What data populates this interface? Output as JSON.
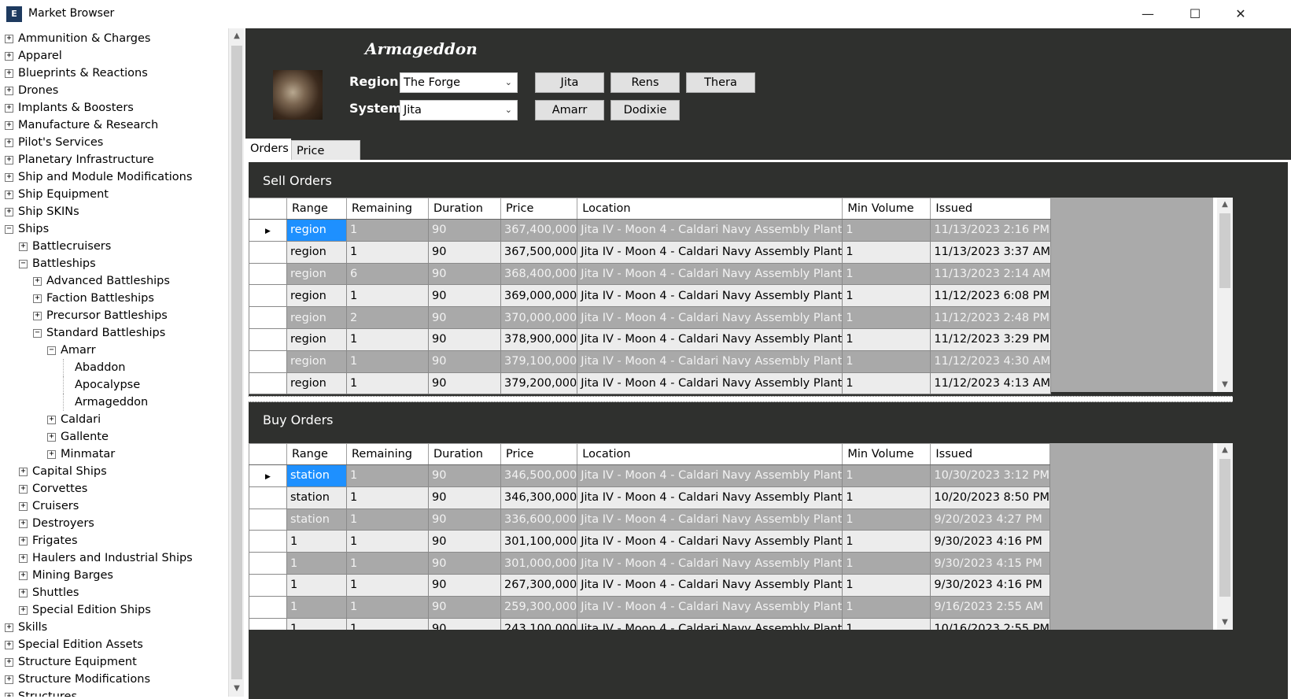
{
  "window": {
    "title": "Market Browser",
    "app_icon": "E"
  },
  "sidebar": {
    "items": [
      {
        "label": "Ammunition & Charges",
        "level": 0,
        "expanded": false
      },
      {
        "label": "Apparel",
        "level": 0,
        "expanded": false
      },
      {
        "label": "Blueprints & Reactions",
        "level": 0,
        "expanded": false
      },
      {
        "label": "Drones",
        "level": 0,
        "expanded": false
      },
      {
        "label": "Implants & Boosters",
        "level": 0,
        "expanded": false
      },
      {
        "label": "Manufacture & Research",
        "level": 0,
        "expanded": false
      },
      {
        "label": "Pilot's Services",
        "level": 0,
        "expanded": false
      },
      {
        "label": "Planetary Infrastructure",
        "level": 0,
        "expanded": false
      },
      {
        "label": "Ship and Module Modifications",
        "level": 0,
        "expanded": false
      },
      {
        "label": "Ship Equipment",
        "level": 0,
        "expanded": false
      },
      {
        "label": "Ship SKINs",
        "level": 0,
        "expanded": false
      },
      {
        "label": "Ships",
        "level": 0,
        "expanded": true
      },
      {
        "label": "Battlecruisers",
        "level": 1,
        "expanded": false
      },
      {
        "label": "Battleships",
        "level": 1,
        "expanded": true
      },
      {
        "label": "Advanced Battleships",
        "level": 2,
        "expanded": false
      },
      {
        "label": "Faction Battleships",
        "level": 2,
        "expanded": false
      },
      {
        "label": "Precursor Battleships",
        "level": 2,
        "expanded": false
      },
      {
        "label": "Standard Battleships",
        "level": 2,
        "expanded": true
      },
      {
        "label": "Amarr",
        "level": 3,
        "expanded": true
      },
      {
        "label": "Abaddon",
        "level": 4,
        "leaf": true
      },
      {
        "label": "Apocalypse",
        "level": 4,
        "leaf": true
      },
      {
        "label": "Armageddon",
        "level": 4,
        "leaf": true
      },
      {
        "label": "Caldari",
        "level": 3,
        "expanded": false
      },
      {
        "label": "Gallente",
        "level": 3,
        "expanded": false
      },
      {
        "label": "Minmatar",
        "level": 3,
        "expanded": false
      },
      {
        "label": "Capital Ships",
        "level": 1,
        "expanded": false
      },
      {
        "label": "Corvettes",
        "level": 1,
        "expanded": false
      },
      {
        "label": "Cruisers",
        "level": 1,
        "expanded": false
      },
      {
        "label": "Destroyers",
        "level": 1,
        "expanded": false
      },
      {
        "label": "Frigates",
        "level": 1,
        "expanded": false
      },
      {
        "label": "Haulers and Industrial Ships",
        "level": 1,
        "expanded": false
      },
      {
        "label": "Mining Barges",
        "level": 1,
        "expanded": false
      },
      {
        "label": "Shuttles",
        "level": 1,
        "expanded": false
      },
      {
        "label": "Special Edition Ships",
        "level": 1,
        "expanded": false
      },
      {
        "label": "Skills",
        "level": 0,
        "expanded": false
      },
      {
        "label": "Special Edition Assets",
        "level": 0,
        "expanded": false
      },
      {
        "label": "Structure Equipment",
        "level": 0,
        "expanded": false
      },
      {
        "label": "Structure Modifications",
        "level": 0,
        "expanded": false
      },
      {
        "label": "Structures",
        "level": 0,
        "expanded": false
      }
    ]
  },
  "item": {
    "name": "Armageddon"
  },
  "filters": {
    "region_label": "Region",
    "region_value": "The Forge",
    "system_label": "System",
    "system_value": "Jita",
    "hub_buttons_row1": [
      "Jita",
      "Rens",
      "Thera"
    ],
    "hub_buttons_row2": [
      "Amarr",
      "Dodixie"
    ]
  },
  "tabs": [
    "Orders",
    "Price History"
  ],
  "columns": [
    "Range",
    "Remaining",
    "Duration",
    "Price",
    "Location",
    "Min Volume",
    "Issued"
  ],
  "sell_orders": {
    "title": "Sell Orders",
    "rows": [
      [
        "region",
        "1",
        "90",
        "367,400,000",
        "Jita IV - Moon 4 - Caldari Navy Assembly Plant",
        "1",
        "11/13/2023 2:16 PM"
      ],
      [
        "region",
        "1",
        "90",
        "367,500,000",
        "Jita IV - Moon 4 - Caldari Navy Assembly Plant",
        "1",
        "11/13/2023 3:37 AM"
      ],
      [
        "region",
        "6",
        "90",
        "368,400,000",
        "Jita IV - Moon 4 - Caldari Navy Assembly Plant",
        "1",
        "11/13/2023 2:14 AM"
      ],
      [
        "region",
        "1",
        "90",
        "369,000,000",
        "Jita IV - Moon 4 - Caldari Navy Assembly Plant",
        "1",
        "11/12/2023 6:08 PM"
      ],
      [
        "region",
        "2",
        "90",
        "370,000,000",
        "Jita IV - Moon 4 - Caldari Navy Assembly Plant",
        "1",
        "11/12/2023 2:48 PM"
      ],
      [
        "region",
        "1",
        "90",
        "378,900,000",
        "Jita IV - Moon 4 - Caldari Navy Assembly Plant",
        "1",
        "11/12/2023 3:29 PM"
      ],
      [
        "region",
        "1",
        "90",
        "379,100,000",
        "Jita IV - Moon 4 - Caldari Navy Assembly Plant",
        "1",
        "11/12/2023 4:30 AM"
      ],
      [
        "region",
        "1",
        "90",
        "379,200,000",
        "Jita IV - Moon 4 - Caldari Navy Assembly Plant",
        "1",
        "11/12/2023 4:13 AM"
      ]
    ]
  },
  "buy_orders": {
    "title": "Buy Orders",
    "rows": [
      [
        "station",
        "1",
        "90",
        "346,500,000",
        "Jita IV - Moon 4 - Caldari Navy Assembly Plant",
        "1",
        "10/30/2023 3:12 PM"
      ],
      [
        "station",
        "1",
        "90",
        "346,300,000",
        "Jita IV - Moon 4 - Caldari Navy Assembly Plant",
        "1",
        "10/20/2023 8:50 PM"
      ],
      [
        "station",
        "1",
        "90",
        "336,600,000",
        "Jita IV - Moon 4 - Caldari Navy Assembly Plant",
        "1",
        "9/20/2023 4:27 PM"
      ],
      [
        "1",
        "1",
        "90",
        "301,100,000",
        "Jita IV - Moon 4 - Caldari Navy Assembly Plant",
        "1",
        "9/30/2023 4:16 PM"
      ],
      [
        "1",
        "1",
        "90",
        "301,000,000",
        "Jita IV - Moon 4 - Caldari Navy Assembly Plant",
        "1",
        "9/30/2023 4:15 PM"
      ],
      [
        "1",
        "1",
        "90",
        "267,300,000",
        "Jita IV - Moon 4 - Caldari Navy Assembly Plant",
        "1",
        "9/30/2023 4:16 PM"
      ],
      [
        "1",
        "1",
        "90",
        "259,300,000",
        "Jita IV - Moon 4 - Caldari Navy Assembly Plant",
        "1",
        "9/16/2023 2:55 AM"
      ],
      [
        "1",
        "1",
        "90",
        "243,100,000",
        "Jita IV - Moon 4 - Caldari Navy Assembly Plant",
        "1",
        "10/16/2023 2:55 PM"
      ]
    ]
  },
  "icons": {
    "expand": "plus-box-icon",
    "collapse": "minus-box-icon",
    "row_pointer": "triangle-right-icon",
    "minimize": "minimize-icon",
    "maximize": "maximize-icon",
    "close": "close-icon"
  },
  "colors": {
    "panel_bg": "#2f302e",
    "row_dark": "#a9a9a9",
    "row_light": "#ececec",
    "selection": "#1e90ff"
  }
}
